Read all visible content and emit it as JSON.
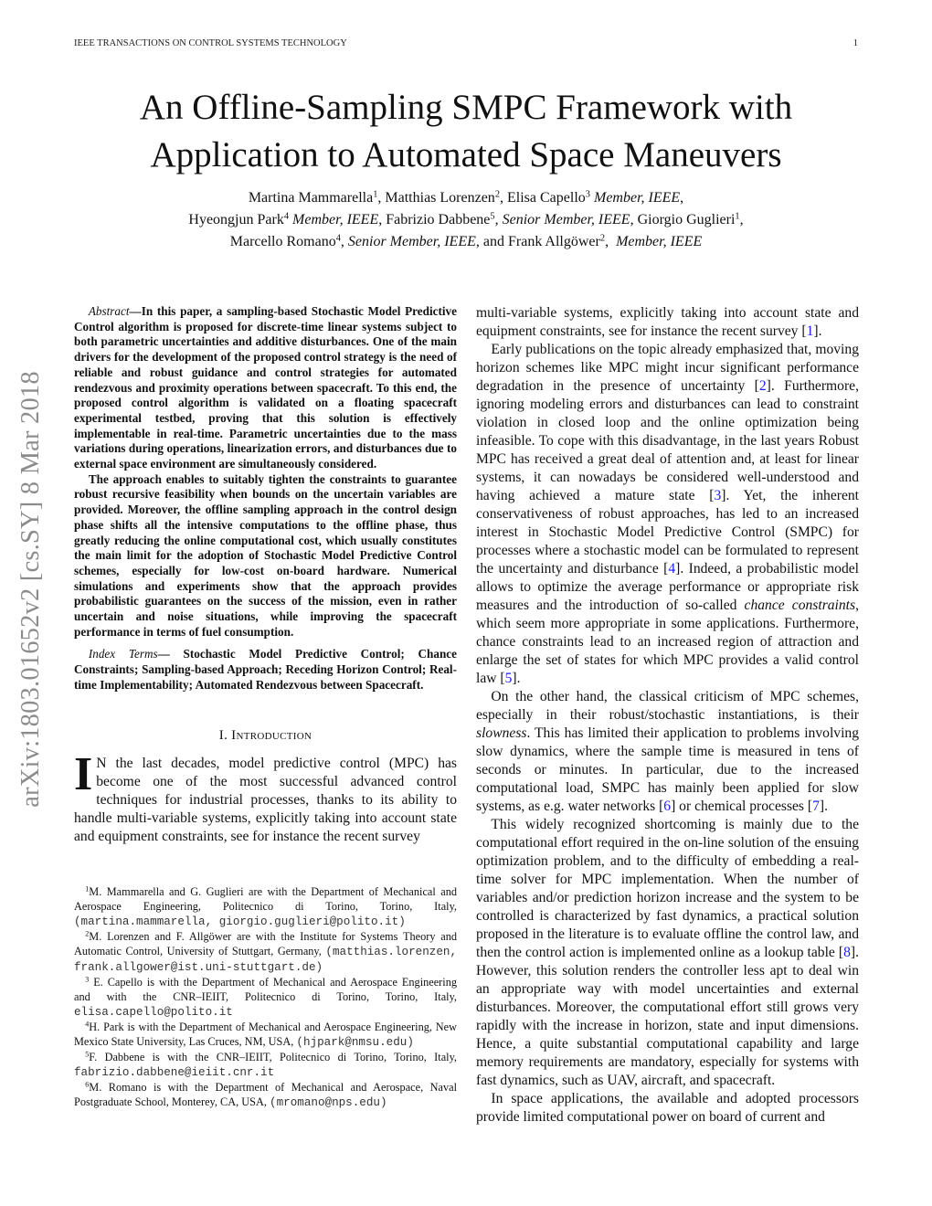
{
  "header": {
    "journal": "IEEE TRANSACTIONS ON CONTROL SYSTEMS TECHNOLOGY",
    "page_number": "1"
  },
  "title": {
    "line1": "An Offline-Sampling SMPC Framework with",
    "line2": "Application to Automated Space Maneuvers"
  },
  "authors": [
    {
      "name": "Martina Mammarella",
      "aff": "1",
      "role": ""
    },
    {
      "name": "Matthias Lorenzen",
      "aff": "2",
      "role": ""
    },
    {
      "name": "Elisa Capello",
      "aff": "3",
      "role": "Member, IEEE"
    },
    {
      "name": "Hyeongjun Park",
      "aff": "4",
      "role": "Member, IEEE"
    },
    {
      "name": "Fabrizio Dabbene",
      "aff": "5",
      "role": "Senior Member, IEEE"
    },
    {
      "name": "Giorgio Guglieri",
      "aff": "1",
      "role": ""
    },
    {
      "name": "Marcello Romano",
      "aff": "4",
      "role": "Senior Member, IEEE"
    },
    {
      "name": "Frank Allgöwer",
      "aff": "2",
      "role": "Member, IEEE"
    }
  ],
  "authors_text": {
    "and": "and"
  },
  "arxiv_stamp": "arXiv:1803.01652v2  [cs.SY]  8 Mar 2018",
  "abstract": {
    "label": "Abstract",
    "para1": "—In this paper, a sampling-based Stochastic Model Predictive Control algorithm is proposed for discrete-time linear systems subject to both parametric uncertainties and additive disturbances. One of the main drivers for the development of the proposed control strategy is the need of reliable and robust guidance and control strategies for automated rendezvous and proximity operations between spacecraft. To this end, the proposed control algorithm is validated on a floating spacecraft experimental testbed, proving that this solution is effectively implementable in real-time. Parametric uncertainties due to the mass variations during operations, linearization errors, and disturbances due to external space environment are simultaneously considered.",
    "para2": "The approach enables to suitably tighten the constraints to guarantee robust recursive feasibility when bounds on the uncertain variables are provided. Moreover, the offline sampling approach in the control design phase shifts all the intensive computations to the offline phase, thus greatly reducing the online computational cost, which usually constitutes the main limit for the adoption of Stochastic Model Predictive Control schemes, especially for low-cost on-board hardware. Numerical simulations and experiments show that the approach provides probabilistic guarantees on the success of the mission, even in rather uncertain and noise situations, while improving the spacecraft performance in terms of fuel consumption."
  },
  "index_terms": {
    "label": "Index Terms",
    "text": "— Stochastic Model Predictive Control; Chance Constraints; Sampling-based Approach; Receding Horizon Control; Real-time Implementability; Automated Rendezvous between Spacecraft."
  },
  "section1": {
    "heading": "I. Introduction",
    "dropcap": "I",
    "p1": "N the last decades, model predictive control (MPC) has become one of the most successful advanced control techniques for industrial processes, thanks to its ability to handle multi-variable systems, explicitly taking into account state and equipment constraints, see for instance the recent survey ",
    "p1_cite": "1",
    "p2a": "Early publications on the topic already emphasized that, moving horizon schemes like MPC might incur significant performance degradation in the presence of uncertainty ",
    "p2_cite1": "2",
    "p2b": ". Furthermore, ignoring modeling errors and disturbances can lead to constraint violation in closed loop and the online optimization being infeasible. To cope with this disadvantage, in the last years Robust MPC has received a great deal of attention and, at least for linear systems, it can nowadays be considered well-understood and having achieved a mature state ",
    "p2_cite2": "3",
    "p2c": ". Yet, the inherent conservativeness of robust approaches, has led to an increased interest in Stochastic Model Predictive Control (SMPC) for processes where a stochastic model can be formulated to represent the uncertainty and disturbance ",
    "p2_cite3": "4",
    "p2d": ". Indeed, a probabilistic model allows to optimize the average performance or appropriate risk measures and the introduction of so-called ",
    "p2_em": "chance constraints",
    "p2e": ", which seem more appropriate in some applications. Furthermore, chance constraints lead to an increased region of attraction and enlarge the set of states for which MPC provides a valid control law ",
    "p2_cite4": "5",
    "p3a": "On the other hand, the classical criticism of MPC schemes, especially in their robust/stochastic instantiations, is their ",
    "p3_em": "slowness",
    "p3b": ". This has limited their application to problems involving slow dynamics, where the sample time is measured in tens of seconds or minutes. In particular, due to the increased computational load, SMPC has mainly been applied for slow systems, as e.g. water networks ",
    "p3_cite1": "6",
    "p3c": " or chemical processes ",
    "p3_cite2": "7",
    "p4a": "This widely recognized shortcoming is mainly due to the computational effort required in the on-line solution of the ensuing optimization problem, and to the difficulty of embedding a real-time solver for MPC implementation. When the number of variables and/or prediction horizon increase and the system to be controlled is characterized by fast dynamics, a practical solution proposed in the literature is to evaluate offline the control law, and then the control action is implemented online as a lookup table ",
    "p4_cite": "8",
    "p4b": ". However, this solution renders the controller less apt to deal win an appropriate way with model uncertainties and external disturbances. Moreover, the computational effort still grows very rapidly with the increase in horizon, state and input dimensions. Hence, a quite substantial computational capability and large memory requirements are mandatory, especially for systems with fast dynamics, such as UAV, aircraft, and spacecraft.",
    "p5": "In space applications, the available and adopted processors provide limited computational power on board of current and"
  },
  "footnotes": [
    {
      "mark": "1",
      "text": "M. Mammarella and G. Guglieri are with the Department of Mechanical and Aerospace Engineering, Politecnico di Torino, Torino, Italy, ",
      "email": "(martina.mammarella, giorgio.guglieri@polito.it)"
    },
    {
      "mark": "2",
      "text": "M. Lorenzen and F. Allgöwer are with the Institute for Systems Theory and Automatic Control, University of Stuttgart, Germany, ",
      "email": "(matthias.lorenzen, frank.allgower@ist.uni-stuttgart.de)"
    },
    {
      "mark": "3",
      "text": " E. Capello is with the Department of Mechanical and Aerospace Engineering and with the CNR–IEIIT, Politecnico di Torino, Torino, Italy, ",
      "email": "elisa.capello@polito.it"
    },
    {
      "mark": "4",
      "text": "H. Park is with the Department of Mechanical and Aerospace Engineering, New Mexico State University, Las Cruces, NM, USA, ",
      "email": "(hjpark@nmsu.edu)"
    },
    {
      "mark": "5",
      "text": "F. Dabbene is with the CNR–IEIIT, Politecnico di Torino, Torino, Italy, ",
      "email": "fabrizio.dabbene@ieiit.cnr.it"
    },
    {
      "mark": "6",
      "text": "M. Romano is with the Department of Mechanical and Aerospace, Naval Postgraduate School, Monterey, CA, USA, ",
      "email": "(mromano@nps.edu)"
    }
  ],
  "colors": {
    "citation": "#1a1aff",
    "arxiv_stamp": "#8c8c8c",
    "text": "#111111"
  }
}
